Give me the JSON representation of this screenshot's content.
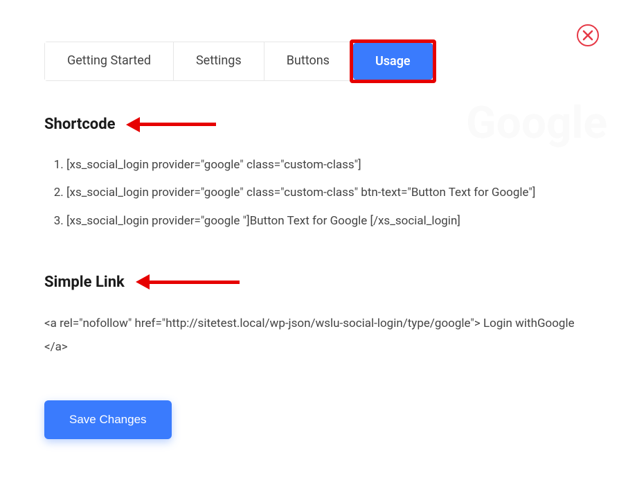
{
  "tabs": {
    "getting_started": "Getting Started",
    "settings": "Settings",
    "buttons": "Buttons",
    "usage": "Usage"
  },
  "watermark": "Google",
  "sections": {
    "shortcode": {
      "title": "Shortcode",
      "items": [
        "[xs_social_login provider=\"google\" class=\"custom-class\"]",
        "[xs_social_login provider=\"google\" class=\"custom-class\" btn-text=\"Button Text for Google\"]",
        "[xs_social_login provider=\"google \"]Button Text for Google [/xs_social_login]"
      ]
    },
    "simple_link": {
      "title": "Simple Link",
      "code": "<a rel=\"nofollow\" href=\"http://sitetest.local/wp-json/wslu-social-login/type/google\"> Login withGoogle </a>"
    }
  },
  "save_button": "Save Changes"
}
